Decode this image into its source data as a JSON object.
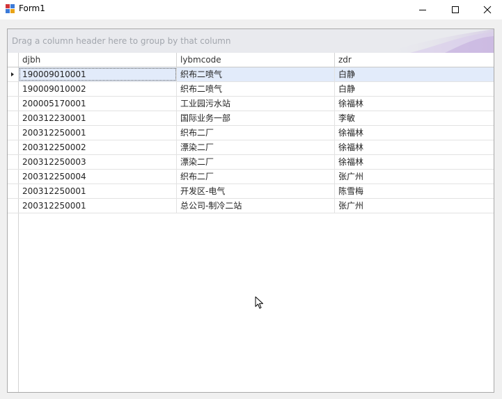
{
  "window": {
    "title": "Form1"
  },
  "grid": {
    "group_panel_text": "Drag a column header here to group by that column",
    "columns": [
      "djbh",
      "lybmcode",
      "zdr"
    ],
    "selected_row": 0,
    "rows": [
      [
        "190009010001",
        "织布二喷气",
        "白静"
      ],
      [
        "190009010002",
        "织布二喷气",
        "白静"
      ],
      [
        "200005170001",
        "工业园污水站",
        "徐福林"
      ],
      [
        "200312230001",
        "国际业务一部",
        "李敏"
      ],
      [
        "200312250001",
        "织布二厂",
        "徐福林"
      ],
      [
        "200312250002",
        "漂染二厂",
        "徐福林"
      ],
      [
        "200312250003",
        "漂染二厂",
        "徐福林"
      ],
      [
        "200312250004",
        "织布二厂",
        "张广州"
      ],
      [
        "200312250001",
        "开发区-电气",
        "陈雪梅"
      ],
      [
        "200312250001",
        "总公司-制冷二站",
        "张广州"
      ]
    ]
  },
  "colors": {
    "selected_row": "#e2ebfa",
    "group_panel": "#e9eaee",
    "group_text": "#a2a6ad"
  },
  "icons": {
    "app": "app-icon",
    "minimize": "minimize-icon",
    "maximize": "maximize-icon",
    "close": "close-icon",
    "row_indicator": "row-indicator-arrow-icon",
    "cursor": "mouse-cursor-icon"
  }
}
